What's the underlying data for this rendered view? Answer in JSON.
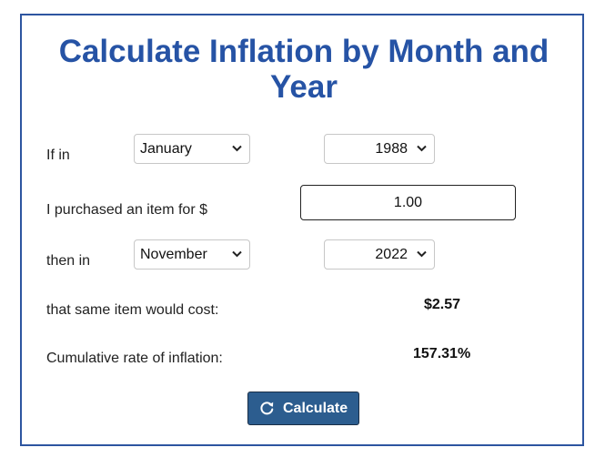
{
  "title_line1": "Calculate Inflation by Month and",
  "title_line2": "Year",
  "labels": {
    "if_in": "If in",
    "purchased": "I purchased an item for $",
    "then_in": "then in",
    "same_item": "that same item would cost:",
    "cumulative": "Cumulative rate of inflation:"
  },
  "start": {
    "month": "January",
    "year": "1988"
  },
  "amount": "1.00",
  "end": {
    "month": "November",
    "year": "2022"
  },
  "results": {
    "cost": "$2.57",
    "rate": "157.31%"
  },
  "button": {
    "label": "Calculate",
    "icon": "refresh-icon"
  },
  "colors": {
    "accent": "#2653a5",
    "button": "#2c5d8f"
  }
}
